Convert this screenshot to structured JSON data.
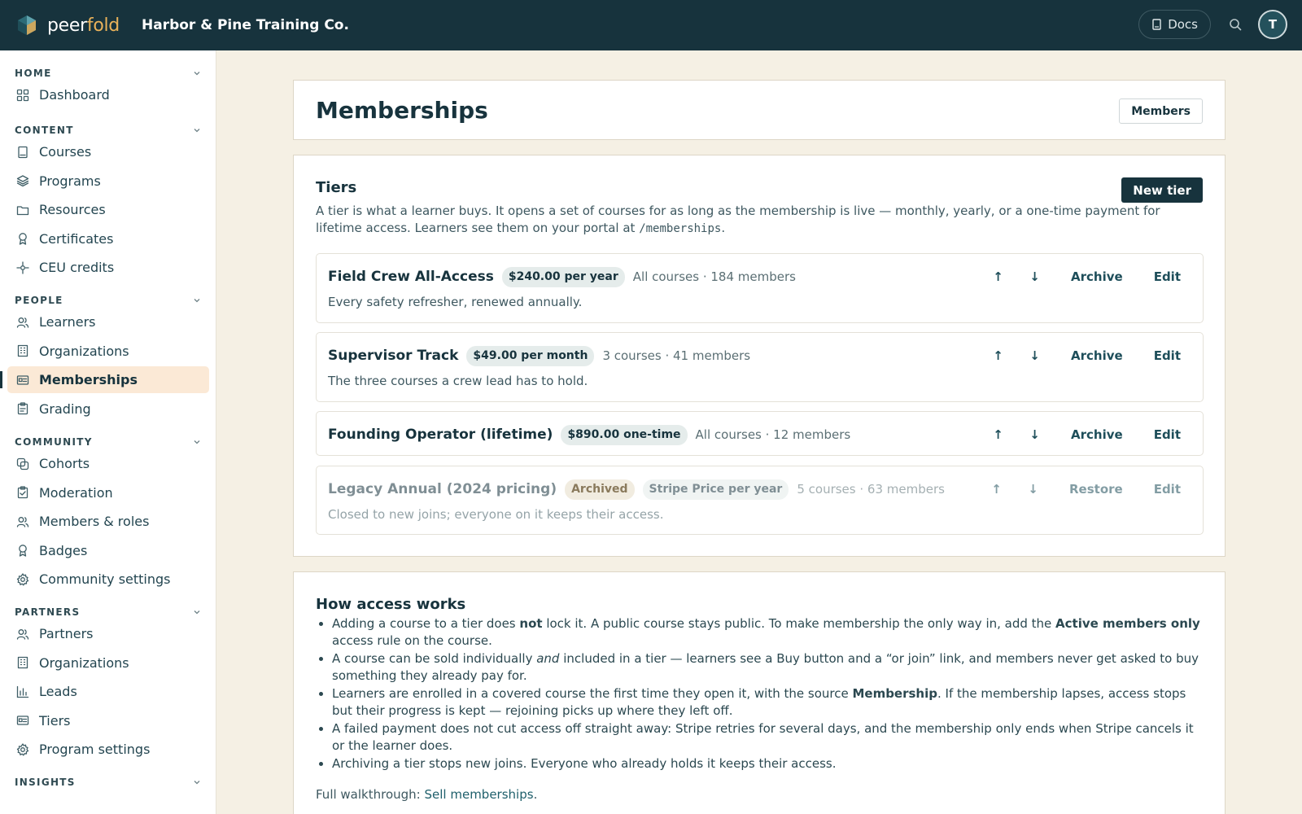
{
  "app": {
    "logo_part1": "peer",
    "logo_part2": "fold",
    "org_name": "Harbor & Pine Training Co.",
    "docs_label": "Docs",
    "avatar_initial": "T"
  },
  "sidebar": {
    "sections": [
      {
        "title": "HOME",
        "items": [
          {
            "label": "Dashboard",
            "icon": "grid-icon"
          }
        ]
      },
      {
        "title": "CONTENT",
        "items": [
          {
            "label": "Courses",
            "icon": "book-icon"
          },
          {
            "label": "Programs",
            "icon": "layers-icon"
          },
          {
            "label": "Resources",
            "icon": "folder-icon"
          },
          {
            "label": "Certificates",
            "icon": "award-icon"
          },
          {
            "label": "CEU credits",
            "icon": "sparkle-icon"
          }
        ]
      },
      {
        "title": "PEOPLE",
        "items": [
          {
            "label": "Learners",
            "icon": "users-icon"
          },
          {
            "label": "Organizations",
            "icon": "building-icon"
          },
          {
            "label": "Memberships",
            "icon": "id-card-icon",
            "active": true
          },
          {
            "label": "Grading",
            "icon": "clipboard-icon"
          }
        ]
      },
      {
        "title": "COMMUNITY",
        "items": [
          {
            "label": "Cohorts",
            "icon": "copy-icon"
          },
          {
            "label": "Moderation",
            "icon": "clipboard-check-icon"
          },
          {
            "label": "Members & roles",
            "icon": "users-icon"
          },
          {
            "label": "Badges",
            "icon": "award-icon"
          },
          {
            "label": "Community settings",
            "icon": "gear-icon"
          }
        ]
      },
      {
        "title": "PARTNERS",
        "items": [
          {
            "label": "Partners",
            "icon": "users-icon"
          },
          {
            "label": "Organizations",
            "icon": "building-icon"
          },
          {
            "label": "Leads",
            "icon": "bar-chart-icon"
          },
          {
            "label": "Tiers",
            "icon": "id-card-icon"
          },
          {
            "label": "Program settings",
            "icon": "gear-icon"
          }
        ]
      },
      {
        "title": "INSIGHTS",
        "items": []
      }
    ]
  },
  "header": {
    "title": "Memberships",
    "members_button": "Members"
  },
  "tiers": {
    "title": "Tiers",
    "new_button": "New tier",
    "description_1": "A tier is what a learner buys. It opens a set of courses for as long as the membership is live — monthly, yearly, or a one-time payment for lifetime access. Learners see them on your portal at ",
    "description_code": "/memberships",
    "description_2": ".",
    "items": [
      {
        "name": "Field Crew All-Access",
        "price": "$240.00 per year",
        "meta": "All courses · 184 members",
        "description": "Every safety refresher, renewed annually.",
        "action": "Archive",
        "edit": "Edit",
        "up": "↑",
        "down": "↓"
      },
      {
        "name": "Supervisor Track",
        "price": "$49.00 per month",
        "meta": "3 courses · 41 members",
        "description": "The three courses a crew lead has to hold.",
        "action": "Archive",
        "edit": "Edit",
        "up": "↑",
        "down": "↓"
      },
      {
        "name": "Founding Operator (lifetime)",
        "price": "$890.00 one-time",
        "meta": "All courses · 12 members",
        "description": "",
        "action": "Archive",
        "edit": "Edit",
        "up": "↑",
        "down": "↓"
      },
      {
        "name": "Legacy Annual (2024 pricing)",
        "status": "Archived",
        "price": "Stripe Price per year",
        "meta": "5 courses · 63 members",
        "description": "Closed to new joins; everyone on it keeps their access.",
        "action": "Restore",
        "edit": "Edit",
        "up": "↑",
        "down": "↓"
      }
    ]
  },
  "how": {
    "title": "How access works",
    "b1": {
      "a": "Adding a course to a tier does ",
      "b": "not",
      "c": " lock it. A public course stays public. To make membership the only way in, add the ",
      "d": "Active members only",
      "e": " access rule on the course."
    },
    "b2": {
      "a": "A course can be sold individually ",
      "b": "and",
      "c": " included in a tier — learners see a Buy button and a “or join” link, and members never get asked to buy something they already pay for."
    },
    "b3": {
      "a": "Learners are enrolled in a covered course the first time they open it, with the source ",
      "b": "Membership",
      "c": ". If the membership lapses, access stops but their progress is kept — rejoining picks up where they left off."
    },
    "b4": "A failed payment does not cut access off straight away: Stripe retries for several days, and the membership only ends when Stripe cancels it or the learner does.",
    "b5": "Archiving a tier stops new joins. Everyone who already holds it keeps their access.",
    "foot_prefix": "Full walkthrough: ",
    "foot_link": "Sell memberships",
    "foot_suffix": "."
  }
}
